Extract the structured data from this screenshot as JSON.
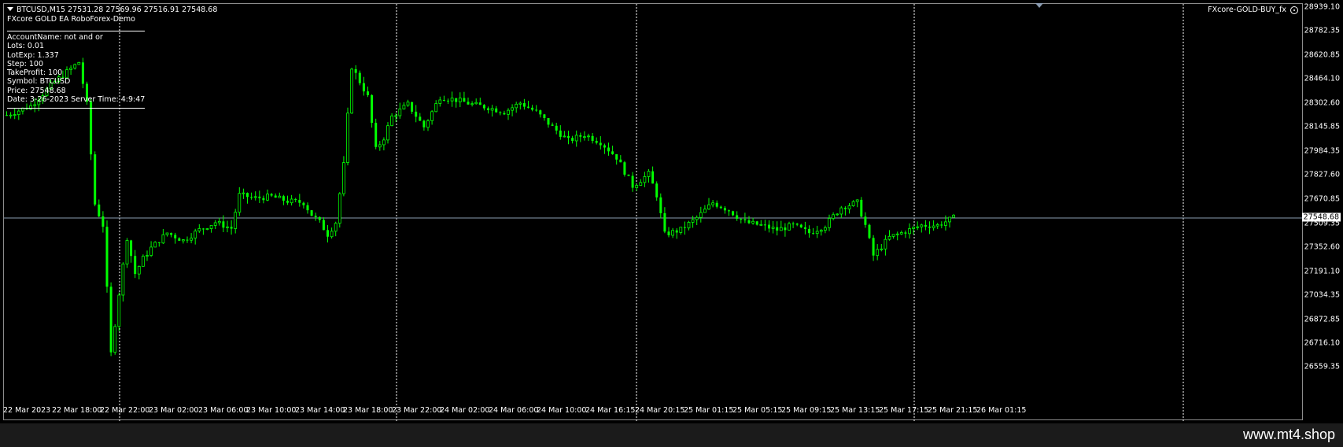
{
  "header": {
    "symbol_line": "BTCUSD,M15  27531.28 27569.96 27516.91 27548.68",
    "ea_name": "FXcore GOLD EA RoboForex-Demo",
    "indicator": "FXcore-GOLD-BUY_fx"
  },
  "info_panel": [
    "AccountName:  not and or",
    "Lots:  0.01",
    "LotExp:  1.337",
    "Step: 100",
    "TakeProfit: 100",
    "Symbol: BTCUSD",
    "Price:  27548.68",
    "Date: 3-26-2023 Server Time: 4:9:47"
  ],
  "price_axis": {
    "ticks": [
      "28939.10",
      "28782.35",
      "28620.85",
      "28464.10",
      "28302.60",
      "28145.85",
      "27984.35",
      "27827.60",
      "27670.85",
      "27509.35",
      "27352.60",
      "27191.10",
      "27034.35",
      "26872.85",
      "26716.10",
      "26559.35"
    ],
    "current_price": "27548.68"
  },
  "time_axis": [
    "22 Mar 2023",
    "22 Mar 18:00",
    "22 Mar 22:00",
    "23 Mar 02:00",
    "23 Mar 06:00",
    "23 Mar 10:00",
    "23 Mar 14:00",
    "23 Mar 18:00",
    "23 Mar 22:00",
    "24 Mar 02:00",
    "24 Mar 06:00",
    "24 Mar 10:00",
    "24 Mar 16:15",
    "24 Mar 20:15",
    "25 Mar 01:15",
    "25 Mar 05:15",
    "25 Mar 09:15",
    "25 Mar 13:15",
    "25 Mar 17:15",
    "25 Mar 21:15",
    "26 Mar 01:15"
  ],
  "footer": {
    "watermark": "www.mt4.shop"
  },
  "colors": {
    "candle": "#00ff00",
    "price_line": "#8a9bb0",
    "background": "#000000",
    "separator": "#ffffff"
  },
  "icons": [
    "dropdown-triangle-icon",
    "settings-icon",
    "chart-shift-icon"
  ],
  "chart_data": {
    "type": "candlestick",
    "symbol": "BTCUSD",
    "timeframe": "M15",
    "ylim": [
      26559.35,
      28939.1
    ],
    "ohlc_last": {
      "open": 27531.28,
      "high": 27569.96,
      "low": 27516.91,
      "close": 27548.68
    },
    "period_separators": [
      "22 Mar 22:00",
      "23 Mar 22:00",
      "24 Mar 20:15",
      "25 Mar 21:15"
    ],
    "close_path": [
      [
        0,
        28230
      ],
      [
        6,
        28290
      ],
      [
        12,
        28450
      ],
      [
        18,
        28580
      ],
      [
        20,
        28300
      ],
      [
        22,
        27640
      ],
      [
        24,
        27500
      ],
      [
        26,
        26650
      ],
      [
        28,
        27050
      ],
      [
        30,
        27420
      ],
      [
        32,
        27180
      ],
      [
        34,
        27280
      ],
      [
        36,
        27350
      ],
      [
        40,
        27450
      ],
      [
        44,
        27400
      ],
      [
        48,
        27470
      ],
      [
        52,
        27520
      ],
      [
        56,
        27480
      ],
      [
        58,
        27700
      ],
      [
        62,
        27680
      ],
      [
        66,
        27690
      ],
      [
        70,
        27660
      ],
      [
        74,
        27650
      ],
      [
        76,
        27570
      ],
      [
        78,
        27520
      ],
      [
        80,
        27440
      ],
      [
        82,
        27520
      ],
      [
        84,
        27900
      ],
      [
        86,
        28550
      ],
      [
        88,
        28450
      ],
      [
        90,
        28350
      ],
      [
        92,
        28000
      ],
      [
        94,
        28080
      ],
      [
        96,
        28220
      ],
      [
        100,
        28300
      ],
      [
        104,
        28150
      ],
      [
        108,
        28350
      ],
      [
        112,
        28330
      ],
      [
        116,
        28300
      ],
      [
        120,
        28280
      ],
      [
        124,
        28250
      ],
      [
        128,
        28310
      ],
      [
        132,
        28250
      ],
      [
        136,
        28150
      ],
      [
        140,
        28060
      ],
      [
        144,
        28100
      ],
      [
        148,
        28050
      ],
      [
        152,
        27950
      ],
      [
        156,
        27760
      ],
      [
        160,
        27840
      ],
      [
        162,
        27700
      ],
      [
        164,
        27440
      ],
      [
        168,
        27470
      ],
      [
        172,
        27550
      ],
      [
        176,
        27650
      ],
      [
        180,
        27600
      ],
      [
        184,
        27520
      ],
      [
        188,
        27500
      ],
      [
        192,
        27470
      ],
      [
        196,
        27500
      ],
      [
        200,
        27450
      ],
      [
        204,
        27500
      ],
      [
        208,
        27620
      ],
      [
        212,
        27650
      ],
      [
        214,
        27500
      ],
      [
        216,
        27300
      ],
      [
        220,
        27420
      ],
      [
        224,
        27460
      ],
      [
        228,
        27500
      ],
      [
        232,
        27500
      ],
      [
        236,
        27548.68
      ]
    ]
  }
}
